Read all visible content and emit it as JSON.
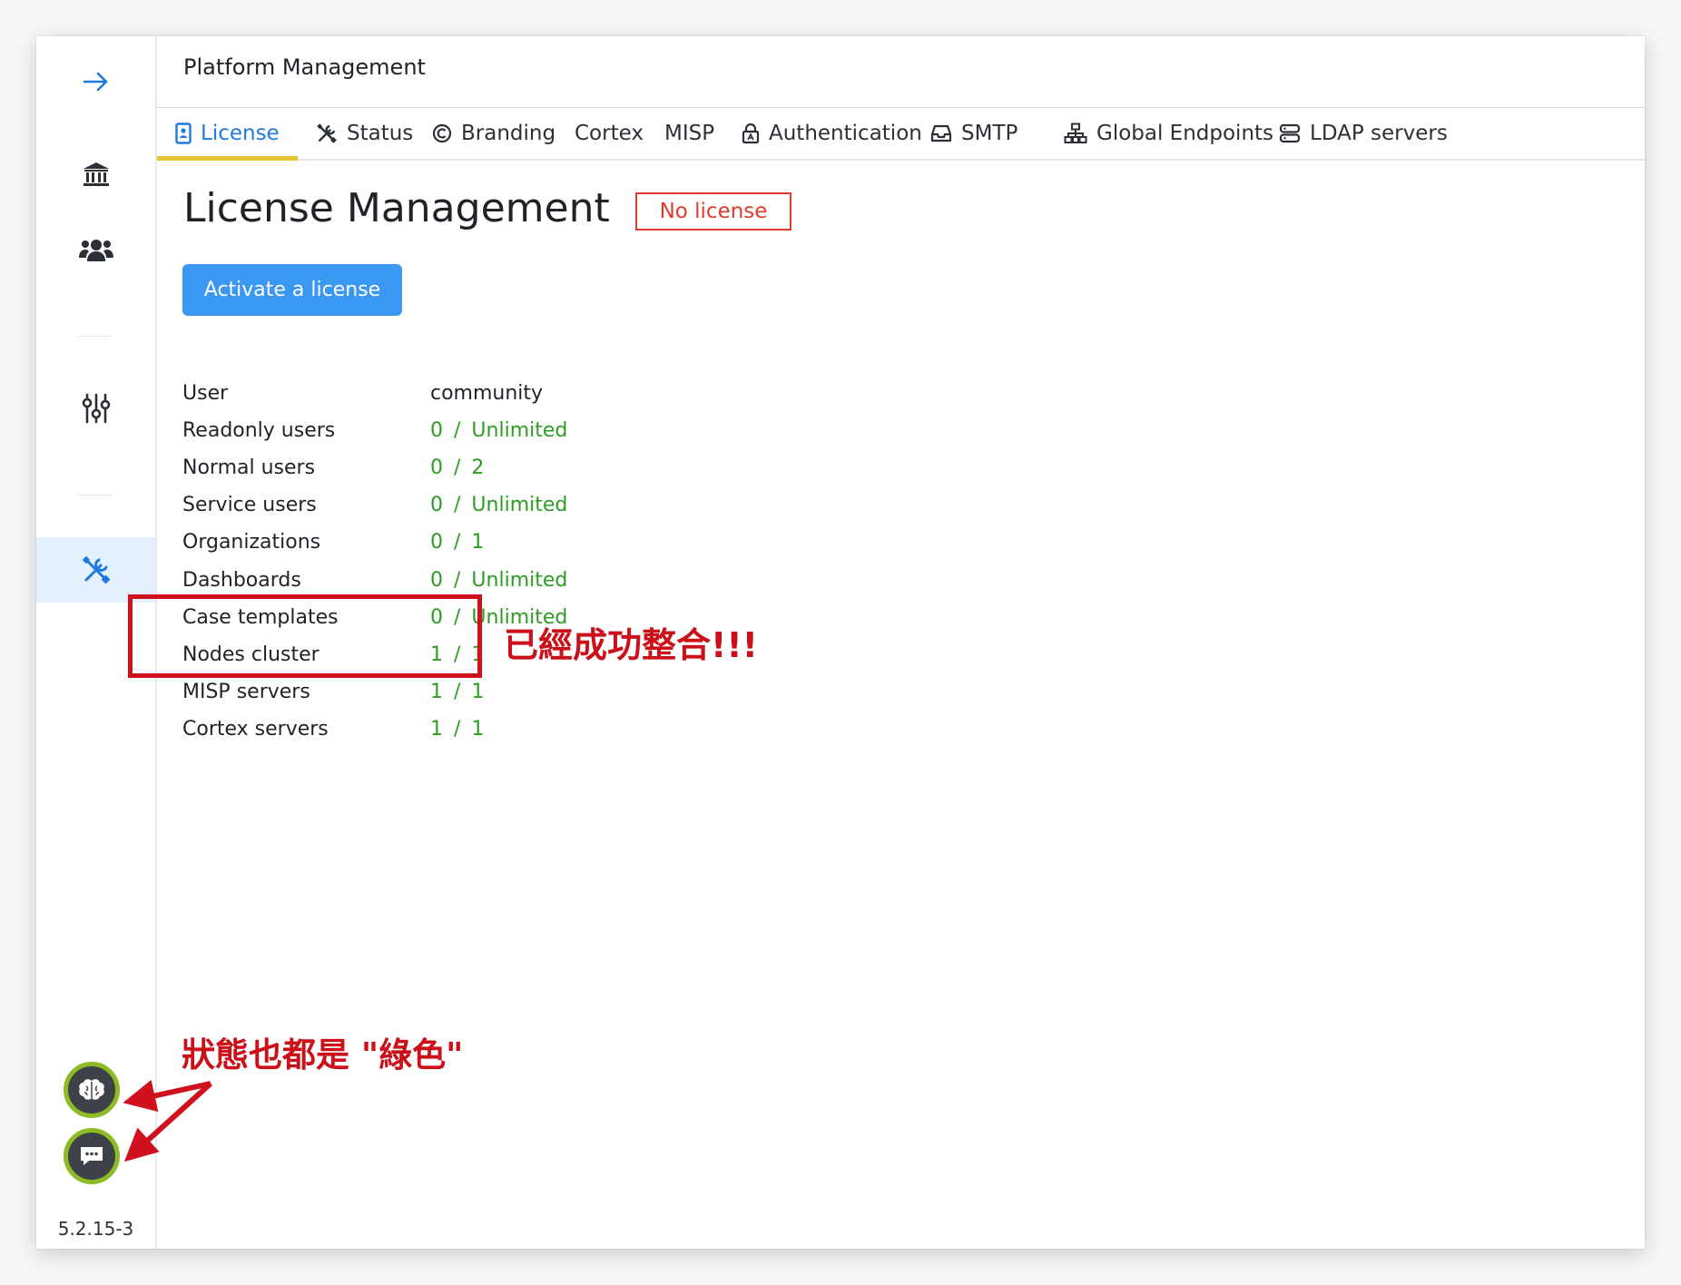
{
  "header": {
    "title": "Platform Management"
  },
  "tabs": [
    {
      "label": "License",
      "icon": "id-badge-icon",
      "active": true
    },
    {
      "label": "Status",
      "icon": "tools-icon"
    },
    {
      "label": "Branding",
      "icon": "copyright-icon"
    },
    {
      "label": "Cortex",
      "icon": ""
    },
    {
      "label": "MISP",
      "icon": ""
    },
    {
      "label": "Authentication",
      "icon": "lock-icon"
    },
    {
      "label": "SMTP",
      "icon": "inbox-icon"
    },
    {
      "label": "Global Endpoints",
      "icon": "network-icon"
    },
    {
      "label": "LDAP servers",
      "icon": "server-icon"
    }
  ],
  "sidebar": {
    "items": [
      {
        "icon": "arrow-right-icon"
      },
      {
        "icon": "bank-icon"
      },
      {
        "icon": "users-icon"
      },
      {
        "icon": "sliders-icon"
      },
      {
        "icon": "tools-icon",
        "active": true
      }
    ],
    "status": [
      {
        "icon": "brain-icon",
        "color": "#8dbb25"
      },
      {
        "icon": "chat-icon",
        "color": "#8dbb25"
      }
    ],
    "version": "5.2.15-3"
  },
  "page": {
    "title": "License Management",
    "badge": "No license",
    "activate_button": "Activate a license"
  },
  "license": {
    "user": {
      "label": "User",
      "value": "community"
    },
    "rows": [
      {
        "label": "Readonly users",
        "used": "0",
        "sep": "/",
        "max": "Unlimited"
      },
      {
        "label": "Normal users",
        "used": "0",
        "sep": "/",
        "max": "2"
      },
      {
        "label": "Service users",
        "used": "0",
        "sep": "/",
        "max": "Unlimited"
      },
      {
        "label": "Organizations",
        "used": "0",
        "sep": "/",
        "max": "1"
      },
      {
        "label": "Dashboards",
        "used": "0",
        "sep": "/",
        "max": "Unlimited"
      },
      {
        "label": "Case templates",
        "used": "0",
        "sep": "/",
        "max": "Unlimited"
      },
      {
        "label": "Nodes cluster",
        "used": "1",
        "sep": "/",
        "max": "1"
      },
      {
        "label": "MISP servers",
        "used": "1",
        "sep": "/",
        "max": "1"
      },
      {
        "label": "Cortex servers",
        "used": "1",
        "sep": "/",
        "max": "1"
      }
    ]
  },
  "annotations": {
    "integration_note": "已經成功整合!!!",
    "status_note": "狀態也都是 \"綠色\""
  },
  "colors": {
    "accent": "#1f7ae0",
    "tab_underline": "#e6c437",
    "ok_green": "#2e9c22",
    "status_ring": "#8dbb25",
    "warning_red": "#e03b2c",
    "annotation_red": "#d0101c"
  }
}
